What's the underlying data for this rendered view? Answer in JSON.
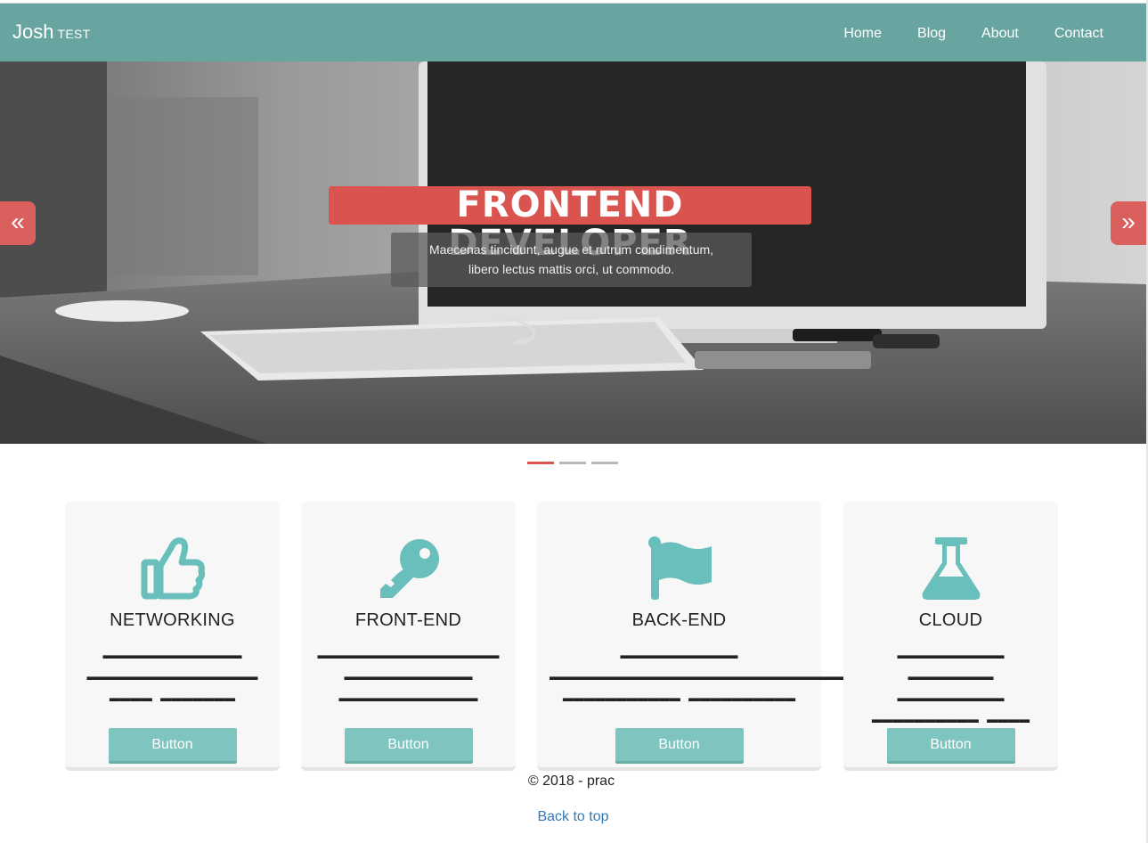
{
  "navbar": {
    "brand": "Josh",
    "brand_sub": "TEST",
    "links": [
      "Home",
      "Blog",
      "About",
      "Contact"
    ],
    "background": "#68a5a0"
  },
  "carousel": {
    "title": "FRONTEND DEVELOPER",
    "caption_line1": "Maecenas tincidunt, augue et rutrum condimentum,",
    "caption_line2": "libero lectus mattis orci, ut commodo.",
    "prev_icon": "double-chevron-left-icon",
    "next_icon": "double-chevron-right-icon",
    "prev_glyph": "«",
    "next_glyph": "»",
    "slide_count": 3,
    "active_slide": 1,
    "accent": "#d9534f"
  },
  "cards": [
    {
      "icon": "thumbs-up-icon",
      "title": "NETWORKING",
      "text": "▬▬▬▬▬▬▬▬▬▬▬▬▬ ▬▬▬▬▬▬▬▬▬▬▬▬▬▬▬▬ ▬▬▬▬ ▬▬▬▬▬▬▬",
      "button": "Button"
    },
    {
      "icon": "key-icon",
      "title": "FRONT-END",
      "text": "▬▬▬▬▬▬▬▬▬▬▬▬▬▬▬▬▬ ▬▬▬▬▬▬▬▬▬▬▬▬ ▬▬▬▬▬▬▬▬▬▬▬▬▬",
      "button": "Button"
    },
    {
      "icon": "flag-icon",
      "title": "BACK-END",
      "text": "▬▬▬▬▬▬▬▬▬▬▬ ▬▬▬▬▬▬▬▬▬▬▬▬▬▬▬▬▬▬▬▬▬▬▬▬▬▬▬▬▬▬▬▬ ▬▬▬▬▬▬▬▬▬▬▬ ▬▬▬▬▬▬▬▬▬▬",
      "button": "Button"
    },
    {
      "icon": "flask-icon",
      "title": "CLOUD",
      "text": "▬▬▬▬▬▬▬▬▬▬ ▬▬▬▬▬▬▬▬ ▬▬▬▬▬▬▬▬▬▬ ▬▬▬▬▬▬▬▬▬▬ ▬▬▬▬ ▬▬▬▬ ▬▬▬",
      "button": "Button"
    }
  ],
  "icon_color": "#68bfbb",
  "footer": {
    "copyright": "© 2018 - prac",
    "back_to_top": "Back to top"
  }
}
